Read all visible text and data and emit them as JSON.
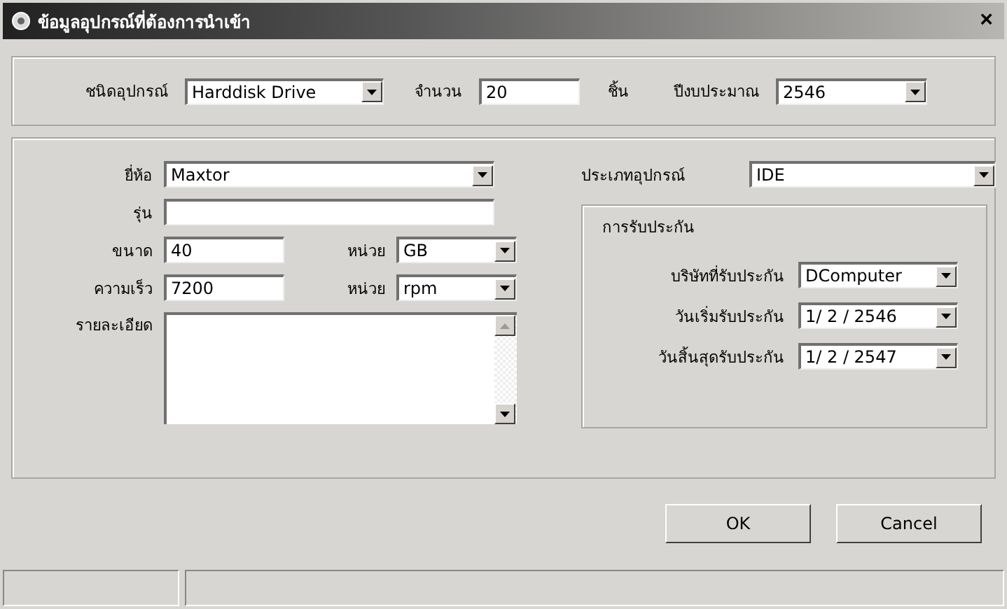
{
  "window": {
    "title": "ข้อมูลอุปกรณ์ที่ต้องการนำเข้า",
    "close": "×"
  },
  "top": {
    "type_label": "ชนิดอุปกรณ์",
    "type_value": "Harddisk Drive",
    "qty_label": "จำนวน",
    "qty_value": "20",
    "qty_unit": "ชิ้น",
    "year_label": "ปีงบประมาณ",
    "year_value": "2546"
  },
  "left": {
    "brand_label": "ยี่ห้อ",
    "brand_value": "Maxtor",
    "model_label": "รุ่น",
    "size_label": "ขนาด",
    "size_value": "40",
    "size_unit_label": "หน่วย",
    "size_unit": "GB",
    "speed_label": "ความเร็ว",
    "speed_value": "7200",
    "speed_unit_label": "หน่วย",
    "speed_unit": "rpm",
    "details_label": "รายละเอียด"
  },
  "right": {
    "kind_label": "ประเภทอุปกรณ์",
    "kind_value": "IDE",
    "warranty_title": "การรับประกัน",
    "warranty_rows": [
      {
        "label": "บริษัทที่รับประกัน",
        "value": "DComputer"
      },
      {
        "label": "วันเริ่มรับประกัน",
        "value": "1/ 2 / 2546"
      },
      {
        "label": "วันสิ้นสุดรับประกัน",
        "value": "1/ 2 / 2547"
      }
    ]
  },
  "buttons": [
    "OK",
    "Cancel"
  ]
}
